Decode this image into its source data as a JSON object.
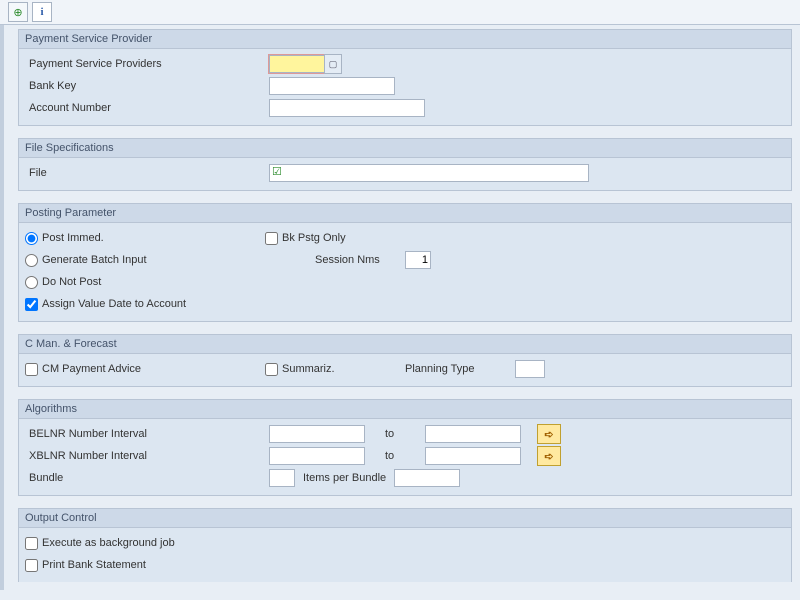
{
  "toolbar": {
    "execute_tip": "Execute",
    "info_tip": "Information"
  },
  "groups": {
    "psp": {
      "title": "Payment Service Provider",
      "providers_label": "Payment Service Providers",
      "providers_value": "",
      "bank_key_label": "Bank Key",
      "bank_key_value": "",
      "account_label": "Account Number",
      "account_value": ""
    },
    "filespec": {
      "title": "File Specifications",
      "file_label": "File",
      "file_value": ""
    },
    "posting": {
      "title": "Posting Parameter",
      "post_immed": "Post Immed.",
      "gen_batch": "Generate Batch Input",
      "do_not_post": "Do Not Post",
      "assign_value_date": "Assign Value Date to Account",
      "bk_pstg_only": "Bk Pstg Only",
      "session_nms": "Session Nms",
      "session_nms_value": "1"
    },
    "cman": {
      "title": "C Man. & Forecast",
      "cm_payment_advice": "CM Payment Advice",
      "summariz": "Summariz.",
      "planning_type": "Planning Type",
      "planning_type_value": ""
    },
    "algo": {
      "title": "Algorithms",
      "belnr": "BELNR Number Interval",
      "xblnr": "XBLNR Number Interval",
      "to": "to",
      "bundle": "Bundle",
      "bundle_value": "",
      "items_per_bundle": "Items per Bundle",
      "items_per_bundle_value": ""
    },
    "output": {
      "title": "Output Control",
      "exec_bg": "Execute as background job",
      "print_stmt": "Print Bank Statement"
    }
  }
}
